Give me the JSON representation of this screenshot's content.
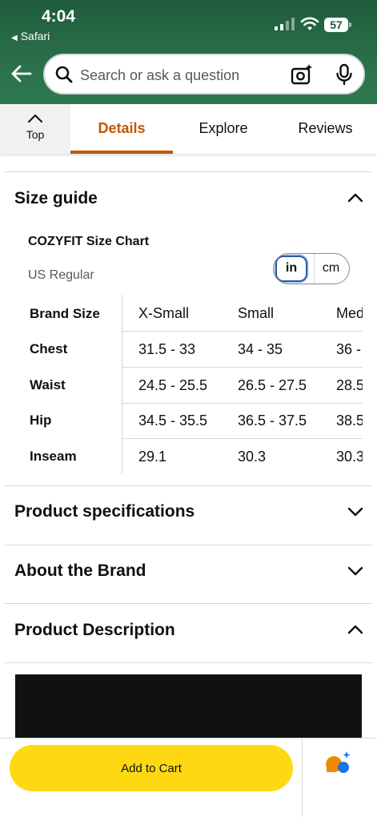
{
  "status_bar": {
    "time": "4:04",
    "back_app": "Safari",
    "battery": "57"
  },
  "search": {
    "placeholder": "Search or ask a question"
  },
  "tabs": [
    {
      "label": "Top"
    },
    {
      "label": "Details",
      "active": true
    },
    {
      "label": "Explore"
    },
    {
      "label": "Reviews"
    }
  ],
  "size_guide": {
    "title": "Size guide",
    "chart_title": "COZYFIT Size Chart",
    "fit": "US Regular",
    "units": [
      "in",
      "cm"
    ],
    "selected_unit": "in",
    "header_label": "Brand Size",
    "columns": [
      "X-Small",
      "Small",
      "Med"
    ],
    "rows": [
      {
        "label": "Chest",
        "values": [
          "31.5 - 33",
          "34 - 35",
          "36 -"
        ]
      },
      {
        "label": "Waist",
        "values": [
          "24.5 - 25.5",
          "26.5 - 27.5",
          "28.5"
        ]
      },
      {
        "label": "Hip",
        "values": [
          "34.5 - 35.5",
          "36.5 - 37.5",
          "38.5"
        ]
      },
      {
        "label": "Inseam",
        "values": [
          "29.1",
          "30.3",
          "30.3"
        ]
      }
    ]
  },
  "sections": {
    "product_specifications": "Product specifications",
    "about_brand": "About the Brand",
    "product_description": "Product Description"
  },
  "bottom_bar": {
    "add_to_cart": "Add to Cart"
  },
  "colors": {
    "header_green": "#2a6e48",
    "accent_orange": "#c45500",
    "cart_yellow": "#ffd814",
    "toggle_blue": "#2c5aa0"
  }
}
